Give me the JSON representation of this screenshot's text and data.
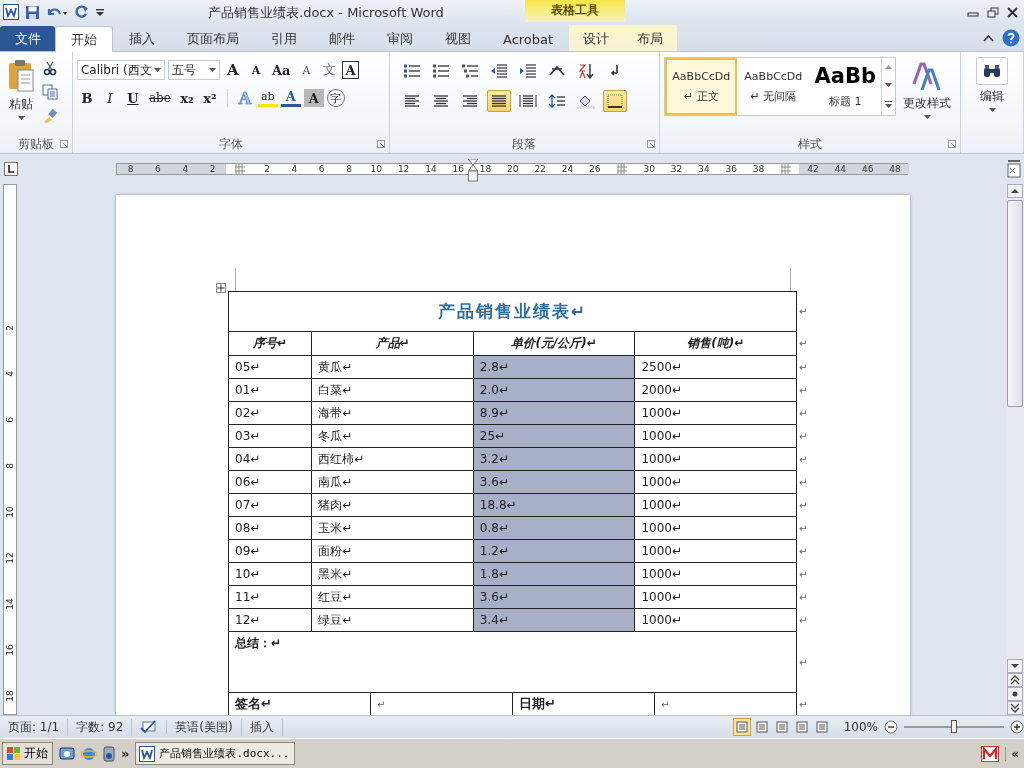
{
  "title_bar": {
    "title": "产品销售业绩表.docx - Microsoft Word",
    "context_label": "表格工具"
  },
  "tabs": [
    {
      "label": "文件",
      "kind": "file",
      "selected": false
    },
    {
      "label": "开始",
      "kind": "tab",
      "selected": true
    },
    {
      "label": "插入",
      "kind": "tab",
      "selected": false
    },
    {
      "label": "页面布局",
      "kind": "tab",
      "selected": false
    },
    {
      "label": "引用",
      "kind": "tab",
      "selected": false
    },
    {
      "label": "邮件",
      "kind": "tab",
      "selected": false
    },
    {
      "label": "审阅",
      "kind": "tab",
      "selected": false
    },
    {
      "label": "视图",
      "kind": "tab",
      "selected": false
    },
    {
      "label": "Acrobat",
      "kind": "tab",
      "selected": false
    },
    {
      "label": "设计",
      "kind": "context",
      "selected": false
    },
    {
      "label": "布局",
      "kind": "context",
      "selected": false
    }
  ],
  "clipboard": {
    "paste": "粘贴",
    "group": "剪贴板"
  },
  "font": {
    "name": "Calibri (西文",
    "size": "五号",
    "group": "字体",
    "row1": [
      {
        "label": "A",
        "kind": "grow"
      },
      {
        "label": "A",
        "kind": "shrink"
      },
      {
        "label": "Aa",
        "kind": "case"
      },
      {
        "label": "A",
        "kind": "clear"
      },
      {
        "label": "文",
        "kind": "phonetic"
      },
      {
        "label": "A",
        "kind": "border"
      }
    ],
    "row2": [
      {
        "label": "B",
        "kind": "bold"
      },
      {
        "label": "I",
        "kind": "italic"
      },
      {
        "label": "U",
        "kind": "underline"
      },
      {
        "label": "abe",
        "kind": "strike"
      },
      {
        "label": "x₂",
        "kind": "sub"
      },
      {
        "label": "x²",
        "kind": "sup"
      }
    ],
    "effects": [
      {
        "label": "A",
        "kind": "effect"
      },
      {
        "label": "ab",
        "kind": "highlight"
      },
      {
        "label": "A",
        "kind": "color"
      },
      {
        "label": "A",
        "kind": "shade"
      },
      {
        "label": "字",
        "kind": "enclose"
      }
    ]
  },
  "paragraph": {
    "group": "段落",
    "row1": [
      {
        "kind": "bullets",
        "selected": false
      },
      {
        "kind": "numbering",
        "selected": false
      },
      {
        "kind": "multilevel",
        "selected": false
      },
      {
        "kind": "outdent",
        "selected": false
      },
      {
        "kind": "indent",
        "selected": false
      },
      {
        "kind": "asian",
        "selected": false
      },
      {
        "kind": "sort",
        "selected": false
      },
      {
        "kind": "marks",
        "selected": false
      }
    ],
    "row2": [
      {
        "kind": "left",
        "selected": false
      },
      {
        "kind": "center",
        "selected": false
      },
      {
        "kind": "right",
        "selected": false
      },
      {
        "kind": "justify",
        "selected": true
      },
      {
        "kind": "distributed",
        "selected": false
      },
      {
        "kind": "spacing",
        "selected": false
      },
      {
        "kind": "shading",
        "selected": false
      },
      {
        "kind": "borders",
        "selected": true
      }
    ]
  },
  "styles": {
    "group": "样式",
    "change": "更改样式",
    "items": [
      {
        "preview": "AaBbCcDd",
        "name": "↵ 正文",
        "kind": "normal",
        "selected": true
      },
      {
        "preview": "AaBbCcDd",
        "name": "↵ 无间隔",
        "kind": "normal",
        "selected": false
      },
      {
        "preview": "AaBb",
        "name": "标题 1",
        "kind": "heading",
        "selected": false
      }
    ]
  },
  "editing": {
    "label": "编辑"
  },
  "ruler": {
    "items": [
      {
        "kind": "number",
        "label": "8"
      },
      {
        "kind": "number",
        "label": "6"
      },
      {
        "kind": "number",
        "label": "4"
      },
      {
        "kind": "number",
        "label": "2"
      },
      {
        "kind": "marker"
      },
      {
        "kind": "number",
        "label": "2"
      },
      {
        "kind": "number",
        "label": "4"
      },
      {
        "kind": "number",
        "label": "6"
      },
      {
        "kind": "number",
        "label": "8"
      },
      {
        "kind": "number",
        "label": "10"
      },
      {
        "kind": "number",
        "label": "12"
      },
      {
        "kind": "number",
        "label": "14"
      },
      {
        "kind": "number",
        "label": "16"
      },
      {
        "kind": "number",
        "label": "18"
      },
      {
        "kind": "number",
        "label": "20"
      },
      {
        "kind": "number",
        "label": "22"
      },
      {
        "kind": "number",
        "label": "24"
      },
      {
        "kind": "number",
        "label": "26"
      },
      {
        "kind": "marker"
      },
      {
        "kind": "number",
        "label": "30"
      },
      {
        "kind": "number",
        "label": "32"
      },
      {
        "kind": "number",
        "label": "34"
      },
      {
        "kind": "number",
        "label": "36"
      },
      {
        "kind": "number",
        "label": "38"
      },
      {
        "kind": "marker"
      },
      {
        "kind": "number",
        "label": "42"
      },
      {
        "kind": "number",
        "label": "44"
      },
      {
        "kind": "number",
        "label": "46"
      },
      {
        "kind": "number",
        "label": "48"
      }
    ]
  },
  "vertical_ruler": {
    "labels": [
      "2",
      "4",
      "6",
      "8",
      "10",
      "12",
      "14",
      "16",
      "18"
    ]
  },
  "table": {
    "title": "产品销售业绩表↵",
    "columns": [
      {
        "label": "序号↵",
        "shaded": false
      },
      {
        "label": "产品↵",
        "shaded": false
      },
      {
        "label": "单价(元/公斤)↵",
        "shaded": true
      },
      {
        "label": "销售(吨)↵",
        "shaded": false
      }
    ],
    "title_end": "↵",
    "header_end": "↵",
    "rows": [
      {
        "cells": [
          "05↵",
          "黄瓜↵",
          "2.8↵",
          "2500↵"
        ],
        "end_mark": "↵"
      },
      {
        "cells": [
          "01↵",
          "白菜↵",
          "2.0↵",
          "2000↵"
        ],
        "end_mark": "↵"
      },
      {
        "cells": [
          "02↵",
          "海带↵",
          "8.9↵",
          "1000↵"
        ],
        "end_mark": "↵"
      },
      {
        "cells": [
          "03↵",
          "冬瓜↵",
          "25↵",
          "1000↵"
        ],
        "end_mark": "↵"
      },
      {
        "cells": [
          "04↵",
          "西红柿↵",
          "3.2↵",
          "1000↵"
        ],
        "end_mark": "↵"
      },
      {
        "cells": [
          "06↵",
          "南瓜↵",
          "3.6↵",
          "1000↵"
        ],
        "end_mark": "↵"
      },
      {
        "cells": [
          "07↵",
          "猪肉↵",
          "18.8↵",
          "1000↵"
        ],
        "end_mark": "↵"
      },
      {
        "cells": [
          "08↵",
          "玉米↵",
          "0.8↵",
          "1000↵"
        ],
        "end_mark": "↵"
      },
      {
        "cells": [
          "09↵",
          "面粉↵",
          "1.2↵",
          "1000↵"
        ],
        "end_mark": "↵"
      },
      {
        "cells": [
          "10↵",
          "黑米↵",
          "1.8↵",
          "1000↵"
        ],
        "end_mark": "↵"
      },
      {
        "cells": [
          "11↵",
          "红豆↵",
          "3.6↵",
          "1000↵"
        ],
        "end_mark": "↵"
      },
      {
        "cells": [
          "12↵",
          "绿豆↵",
          "3.4↵",
          "1000↵"
        ],
        "end_mark": "↵"
      }
    ],
    "summary": "总结：↵",
    "summary_end": "↵",
    "signature": [
      "签名↵",
      "↵",
      "日期↵",
      "↵"
    ],
    "signature_end": "↵"
  },
  "status_bar": {
    "page": "页面: 1/1",
    "words": "字数: 92",
    "language": "英语(美国)",
    "mode": "插入",
    "views": [
      {
        "selected": true
      },
      {
        "selected": false
      },
      {
        "selected": false
      },
      {
        "selected": false
      },
      {
        "selected": false
      }
    ],
    "zoom": "100%",
    "zoom_slider": {
      "level": 0.5
    }
  },
  "taskbar": {
    "start": "开始",
    "more": "»",
    "task": "产品销售业绩表.docx...",
    "tray_toggle": "«"
  }
}
